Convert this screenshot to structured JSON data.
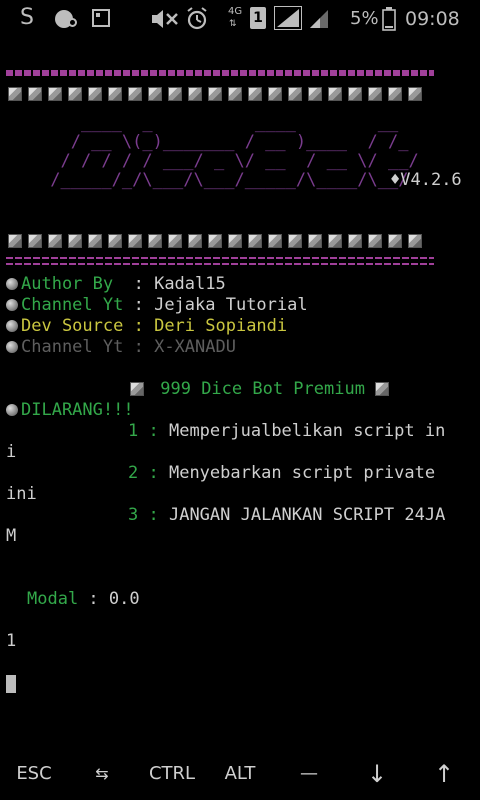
{
  "status_bar": {
    "app_icon_s": "S",
    "network_type": "4G",
    "sim_slot": "1",
    "battery_percent": "5%",
    "time": "09:08",
    "icons": [
      "sim-icon",
      "image-icon",
      "mute-icon",
      "alarm-icon",
      "signal-icon",
      "battery-icon"
    ]
  },
  "terminal": {
    "banner": {
      "ascii_art": [
        "    ____  _          ____        __ ",
        "   / __ \\(_)_______ / __ )____  / /_",
        "  / / / / / ___/ _ \\/ __  / __ \\/ __/",
        " /_____/_/\\___/\\___/_____/\\____/\\__/"
      ],
      "diamond": "♦",
      "version": "V4.2.6"
    },
    "info": [
      {
        "label": "Author By  ",
        "sep": ": ",
        "value": "Kadal15",
        "style": "g-w"
      },
      {
        "label": "Channel Yt ",
        "sep": ": ",
        "value": "Jejaka Tutorial",
        "style": "g-w"
      },
      {
        "label": "Dev Source ",
        "sep": ": ",
        "value": "Deri Sopiandi",
        "style": "y-y"
      },
      {
        "label": "Channel Yt ",
        "sep": ": ",
        "value": "X-XANADU",
        "style": "gr-gr"
      }
    ],
    "title": "999 Dice Bot Premium",
    "warning_label": "DILARANG!!!",
    "rules": [
      {
        "num": "1",
        "sep": " : ",
        "text": "Memperjualbelikan script in",
        "wrap": "i"
      },
      {
        "num": "2",
        "sep": " : ",
        "text": "Menyebarkan script private ",
        "wrap": "ini"
      },
      {
        "num": "3",
        "sep": " : ",
        "text": "JANGAN JALANKAN SCRIPT 24JA",
        "wrap": "M"
      }
    ],
    "modal": {
      "label": "Modal",
      "sep": " : ",
      "value": "0.0"
    },
    "input_echo": "1"
  },
  "extra_keys": [
    "ESC",
    "⇆",
    "CTRL",
    "ALT",
    "—",
    "↓",
    "↑"
  ]
}
